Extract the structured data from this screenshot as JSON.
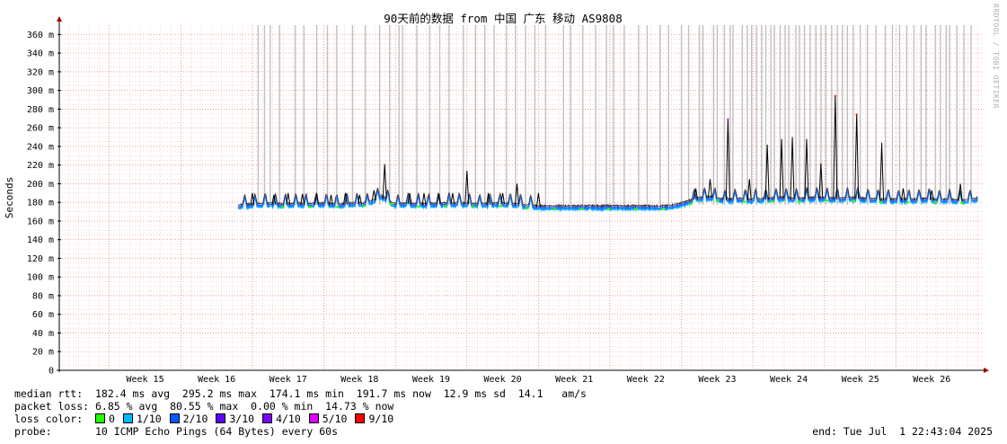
{
  "chart_data": {
    "type": "line",
    "title": "90天前的数据 from 中国 广东 移动 AS9808",
    "ylabel": "Seconds",
    "xlabel": "",
    "ylim": [
      0,
      0.37
    ],
    "y_ticks": [
      {
        "v": 0,
        "label": "0"
      },
      {
        "v": 0.02,
        "label": "20 m"
      },
      {
        "v": 0.04,
        "label": "40 m"
      },
      {
        "v": 0.06,
        "label": "60 m"
      },
      {
        "v": 0.08,
        "label": "80 m"
      },
      {
        "v": 0.1,
        "label": "100 m"
      },
      {
        "v": 0.12,
        "label": "120 m"
      },
      {
        "v": 0.14,
        "label": "140 m"
      },
      {
        "v": 0.16,
        "label": "160 m"
      },
      {
        "v": 0.18,
        "label": "180 m"
      },
      {
        "v": 0.2,
        "label": "200 m"
      },
      {
        "v": 0.22,
        "label": "220 m"
      },
      {
        "v": 0.24,
        "label": "240 m"
      },
      {
        "v": 0.26,
        "label": "260 m"
      },
      {
        "v": 0.28,
        "label": "280 m"
      },
      {
        "v": 0.3,
        "label": "300 m"
      },
      {
        "v": 0.32,
        "label": "320 m"
      },
      {
        "v": 0.34,
        "label": "340 m"
      },
      {
        "v": 0.36,
        "label": "360 m"
      }
    ],
    "x_range_weeks": [
      14.3,
      27.2
    ],
    "x_ticks": [
      "Week 15",
      "Week 16",
      "Week 17",
      "Week 18",
      "Week 19",
      "Week 20",
      "Week 21",
      "Week 22",
      "Week 23",
      "Week 24",
      "Week 25",
      "Week 26"
    ],
    "x_tick_weeks": [
      15,
      16,
      17,
      18,
      19,
      20,
      21,
      22,
      23,
      24,
      25,
      26
    ],
    "data_start_week": 16.8,
    "grid": true,
    "series": [
      {
        "name": "median rtt",
        "week": [
          16.8,
          17.0,
          17.2,
          17.4,
          17.6,
          17.8,
          18.0,
          18.2,
          18.4,
          18.6,
          18.8,
          19.0,
          19.2,
          19.4,
          19.6,
          19.8,
          20.0,
          20.2,
          20.4,
          20.6,
          20.8,
          21.0,
          21.2,
          21.4,
          21.6,
          21.8,
          22.0,
          22.2,
          22.4,
          22.6,
          22.8,
          23.0,
          23.2,
          23.4,
          23.6,
          23.8,
          24.0,
          24.2,
          24.4,
          24.6,
          24.8,
          25.0,
          25.2,
          25.4,
          25.6,
          25.8,
          26.0,
          26.2,
          26.4,
          26.6,
          26.8,
          27.0,
          27.15
        ],
        "rtt": [
          0.176,
          0.177,
          0.178,
          0.177,
          0.178,
          0.177,
          0.178,
          0.177,
          0.178,
          0.178,
          0.186,
          0.177,
          0.178,
          0.177,
          0.178,
          0.178,
          0.178,
          0.177,
          0.178,
          0.178,
          0.176,
          0.175,
          0.175,
          0.175,
          0.175,
          0.175,
          0.175,
          0.175,
          0.175,
          0.175,
          0.175,
          0.178,
          0.183,
          0.185,
          0.182,
          0.183,
          0.182,
          0.183,
          0.184,
          0.183,
          0.184,
          0.184,
          0.183,
          0.184,
          0.183,
          0.182,
          0.182,
          0.182,
          0.183,
          0.182,
          0.182,
          0.181,
          0.184
        ]
      }
    ],
    "spikes": [
      {
        "week": 17.0,
        "max": 0.19
      },
      {
        "week": 17.3,
        "max": 0.188
      },
      {
        "week": 17.5,
        "max": 0.19
      },
      {
        "week": 17.7,
        "max": 0.189
      },
      {
        "week": 17.9,
        "max": 0.19
      },
      {
        "week": 18.1,
        "max": 0.188
      },
      {
        "week": 18.3,
        "max": 0.19
      },
      {
        "week": 18.5,
        "max": 0.188
      },
      {
        "week": 18.7,
        "max": 0.193
      },
      {
        "week": 18.85,
        "max": 0.221
      },
      {
        "week": 19.2,
        "max": 0.19
      },
      {
        "week": 19.4,
        "max": 0.19
      },
      {
        "week": 19.6,
        "max": 0.19
      },
      {
        "week": 19.8,
        "max": 0.19
      },
      {
        "week": 20.0,
        "max": 0.214
      },
      {
        "week": 20.3,
        "max": 0.19
      },
      {
        "week": 20.5,
        "max": 0.19
      },
      {
        "week": 20.7,
        "max": 0.2
      },
      {
        "week": 21.0,
        "max": 0.19
      },
      {
        "week": 23.2,
        "max": 0.195
      },
      {
        "week": 23.4,
        "max": 0.205
      },
      {
        "week": 23.65,
        "max": 0.27
      },
      {
        "week": 23.95,
        "max": 0.205
      },
      {
        "week": 24.2,
        "max": 0.242
      },
      {
        "week": 24.4,
        "max": 0.248
      },
      {
        "week": 24.55,
        "max": 0.25
      },
      {
        "week": 24.75,
        "max": 0.248
      },
      {
        "week": 24.95,
        "max": 0.222
      },
      {
        "week": 25.15,
        "max": 0.295
      },
      {
        "week": 25.45,
        "max": 0.275
      },
      {
        "week": 25.8,
        "max": 0.244
      },
      {
        "week": 26.1,
        "max": 0.195
      },
      {
        "week": 26.5,
        "max": 0.193
      },
      {
        "week": 26.9,
        "max": 0.2
      }
    ],
    "loss_weeks": [
      17.08,
      17.17,
      17.25,
      17.38,
      17.6,
      17.72,
      17.9,
      18.05,
      18.18,
      18.4,
      18.58,
      18.78,
      18.92,
      19.05,
      19.1,
      19.3,
      19.48,
      19.62,
      19.75,
      19.95,
      20.12,
      20.25,
      20.38,
      20.55,
      20.68,
      20.82,
      20.95,
      21.1,
      21.35,
      21.45,
      21.62,
      21.8,
      21.95,
      22.05,
      22.2,
      22.4,
      22.52,
      22.7,
      22.82,
      23.0,
      23.1,
      23.25,
      23.3,
      23.45,
      23.5,
      23.6,
      23.68,
      23.72,
      23.85,
      23.92,
      23.98,
      24.05,
      24.12,
      24.18,
      24.25,
      24.3,
      24.38,
      24.45,
      24.5,
      24.6,
      24.65,
      24.72,
      24.8,
      24.88,
      24.95,
      25.02,
      25.1,
      25.18,
      25.25,
      25.32,
      25.4,
      25.5,
      25.6,
      25.72,
      25.85,
      25.95,
      26.05,
      26.15,
      26.25,
      26.35,
      26.42,
      26.55,
      26.62,
      26.7,
      26.75,
      26.85,
      26.95,
      27.05
    ]
  },
  "colors": {
    "grid": "#ffb8b8",
    "grid_major": "#e07070",
    "loss_bar": "#c0c0c0",
    "axis": "#000000",
    "axis_arrow": "#a00000",
    "spike": "#000000",
    "line_blue": "#3060ff",
    "line_cyan": "#00b0ff",
    "loss0": "#26ff00",
    "loss1": "#00b8ff",
    "loss2": "#0059ff",
    "loss3": "#5e00ff",
    "loss4": "#7e00ff",
    "loss5": "#dd00ff",
    "loss9": "#ff0000"
  },
  "stats": {
    "rtt_line": "median rtt:  182.4 ms avg  295.2 ms max  174.1 ms min  191.7 ms now  12.9 ms sd  14.1   am/s",
    "loss_line": "packet loss: 6.85 % avg  80.55 % max  0.00 % min  14.73 % now",
    "loss_color_label": "loss color:",
    "loss_colors": [
      {
        "label": "0",
        "color": "#26ff00"
      },
      {
        "label": "1/10",
        "color": "#00b8ff"
      },
      {
        "label": "2/10",
        "color": "#0059ff"
      },
      {
        "label": "3/10",
        "color": "#5e00ff"
      },
      {
        "label": "4/10",
        "color": "#7e00ff"
      },
      {
        "label": "5/10",
        "color": "#dd00ff"
      },
      {
        "label": "9/10",
        "color": "#ff0000"
      }
    ],
    "probe_line": "probe:       10 ICMP Echo Pings (64 Bytes) every 60s",
    "end_line": "end: Tue Jul  1 22:43:04 2025"
  },
  "watermark": "RRDTOOL / TOBI OETIKER"
}
